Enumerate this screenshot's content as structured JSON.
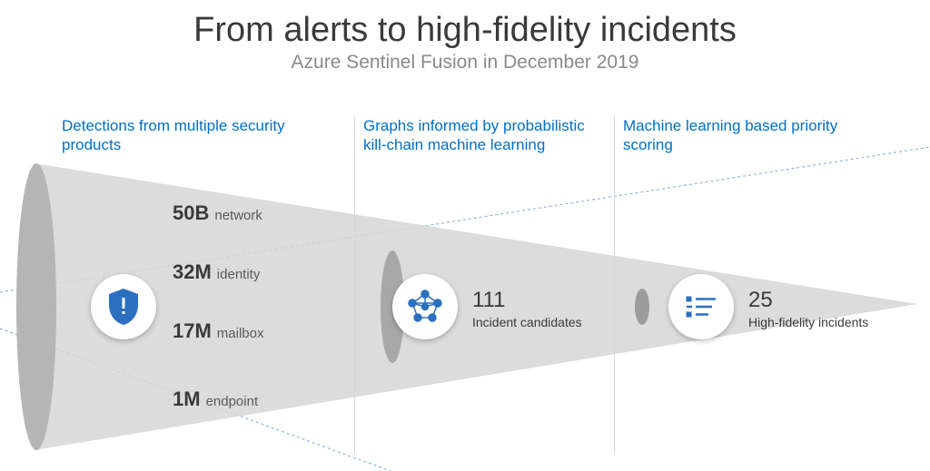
{
  "title": "From alerts to high-fidelity incidents",
  "subtitle": "Azure Sentinel Fusion in December 2019",
  "columns": [
    {
      "heading": "Detections from multiple security products",
      "metrics": [
        {
          "value": "50B",
          "label": "network"
        },
        {
          "value": "32M",
          "label": "identity"
        },
        {
          "value": "17M",
          "label": "mailbox"
        },
        {
          "value": "1M",
          "label": "endpoint"
        }
      ]
    },
    {
      "heading": "Graphs informed by probabilistic kill-chain machine learning",
      "value": "111",
      "label": "Incident candidates"
    },
    {
      "heading": "Machine learning based priority scoring",
      "value": "25",
      "label": "High-fidelity incidents"
    }
  ],
  "colors": {
    "accent": "#1f6fc0",
    "funnel_fill": "#d3d3d3",
    "funnel_stroke": "#7fa9d6"
  }
}
